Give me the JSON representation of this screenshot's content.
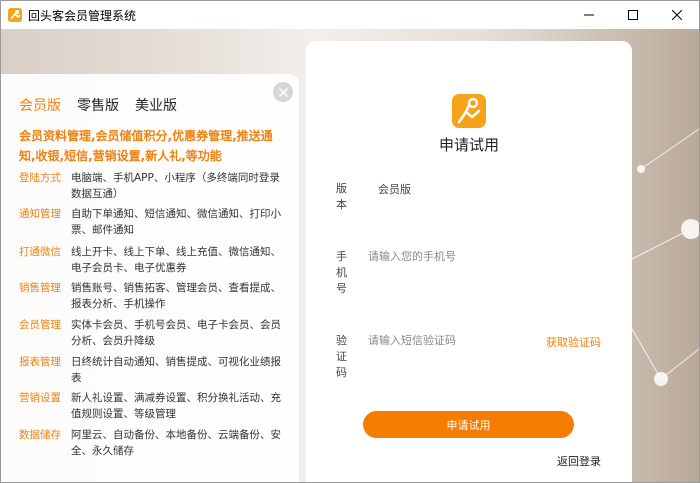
{
  "window": {
    "title": "回头客会员管理系统",
    "controls": {
      "minimize_icon": "minimize-icon",
      "maximize_icon": "maximize-icon",
      "close_icon": "close-icon"
    }
  },
  "colors": {
    "accent": "#f0820f",
    "button": "#f57c00",
    "logo": "#f7a21b"
  },
  "feature_panel": {
    "tabs": [
      {
        "label": "会员版",
        "active": true
      },
      {
        "label": "零售版",
        "active": false
      },
      {
        "label": "美业版",
        "active": false
      }
    ],
    "intro": "会员资料管理,会员储值积分,优惠券管理,推送通知,收银,短信,营销设置,新人礼,等功能",
    "features": [
      {
        "name": "登陆方式",
        "desc": "电脑端、手机APP、小程序（多终端同时登录 数据互通）"
      },
      {
        "name": "通知管理",
        "desc": "自助下单通知、短信通知、微信通知、打印小票、邮件通知"
      },
      {
        "name": "打通微信",
        "desc": "线上开卡、线上下单、线上充值、微信通知、电子会员卡、电子优惠券"
      },
      {
        "name": "销售管理",
        "desc": "销售账号、销售拓客、管理会员、查看提成、报表分析、手机操作"
      },
      {
        "name": "会员管理",
        "desc": "实体卡会员、手机号会员、电子卡会员、会员分析、会员升降级"
      },
      {
        "name": "报表管理",
        "desc": "日终统计自动通知、销售提成、可视化业绩报表"
      },
      {
        "name": "营销设置",
        "desc": "新人礼设置、满减券设置、积分换礼活动、充值规则设置、等级管理"
      },
      {
        "name": "数据储存",
        "desc": "阿里云、自动备份、本地备份、云端备份、安全、永久储存"
      }
    ]
  },
  "form": {
    "title": "申请试用",
    "version_label": "版本",
    "version_value": "会员版",
    "phone_label": "手机号",
    "phone_placeholder": "请输入您的手机号",
    "phone_value": "",
    "code_label": "验证码",
    "code_placeholder": "请输入短信验证码",
    "code_value": "",
    "get_code": "获取验证码",
    "submit": "申请试用",
    "back_login": "返回登录"
  }
}
